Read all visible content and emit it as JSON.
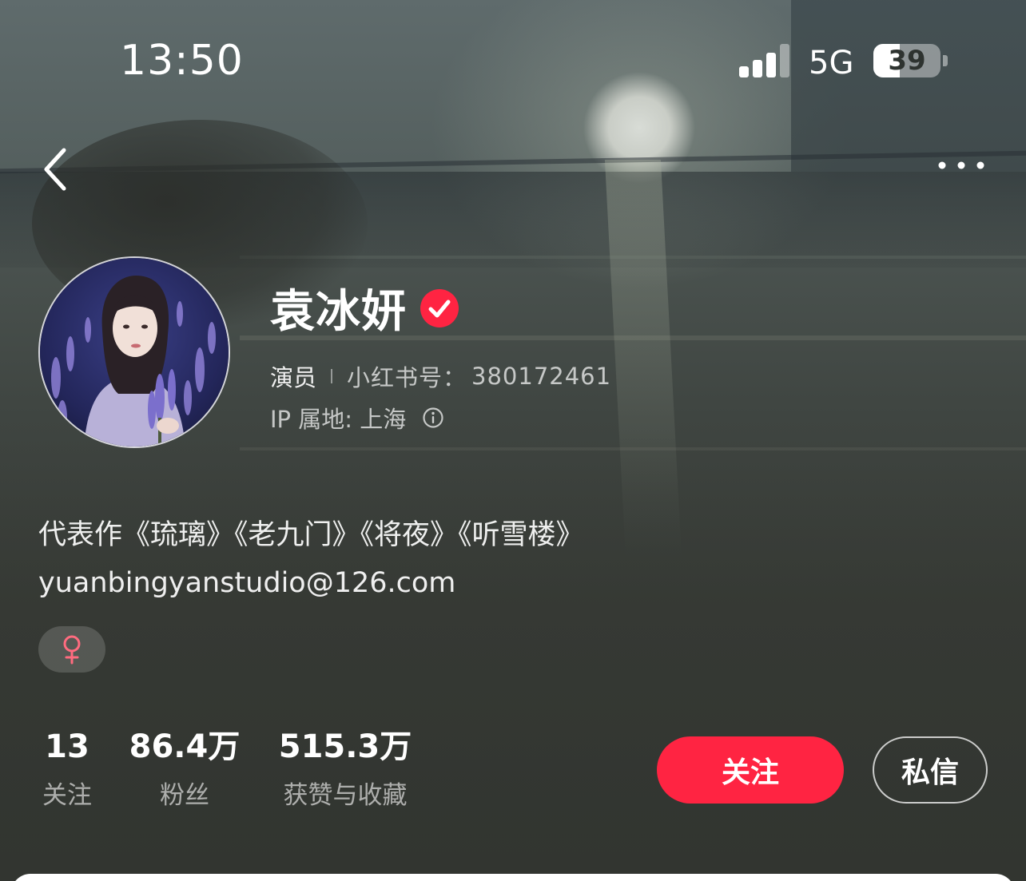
{
  "status_bar": {
    "time": "13:50",
    "network": "5G",
    "battery": "39",
    "battery_level": 0.39,
    "signal_bars": 3
  },
  "nav": {
    "back_icon": "chevron-left-icon",
    "more_icon": "more-dots-icon"
  },
  "profile": {
    "name": "袁冰妍",
    "verified_icon": "verified-check-icon",
    "verified_color": "#ff2442",
    "role": "演员",
    "id_label": "小红书号：",
    "id_value": "380172461",
    "ip_label": "IP 属地: 上海",
    "info_icon": "info-circle-icon",
    "bio_line1": "代表作《琉璃》《老九门》《将夜》《听雪楼》",
    "bio_line2": "yuanbingyanstudio@126.com",
    "gender_icon": "female-icon",
    "gender_color": "#ff6b7f"
  },
  "stats": [
    {
      "value": "13",
      "label": "关注"
    },
    {
      "value": "86.4万",
      "label": "粉丝"
    },
    {
      "value": "515.3万",
      "label": "获赞与收藏"
    }
  ],
  "actions": {
    "follow_label": "关注",
    "message_label": "私信",
    "accent_color": "#ff2442"
  }
}
